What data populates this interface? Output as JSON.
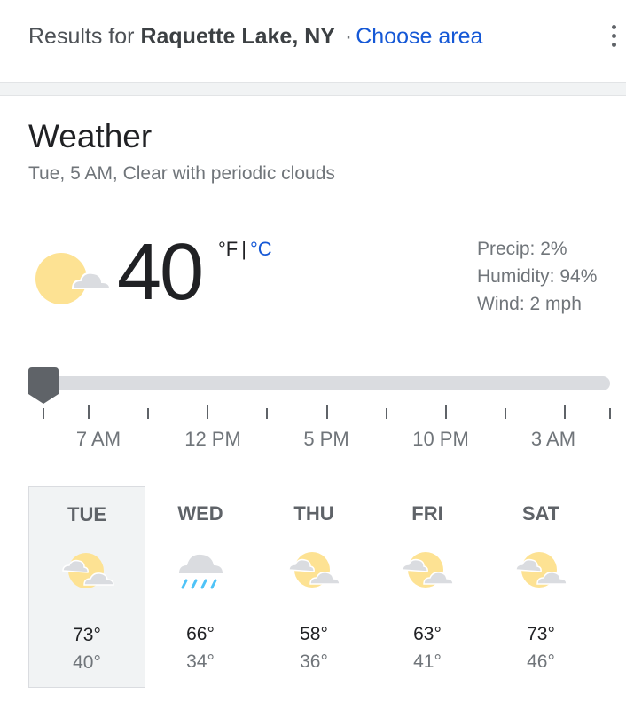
{
  "header": {
    "prefix": "Results for",
    "location": "Raquette Lake, NY",
    "separator": "·",
    "choose_area": "Choose area",
    "menu_icon": "more-vert-icon"
  },
  "weather": {
    "title": "Weather",
    "subtitle": "Tue, 5 AM, Clear with periodic clouds",
    "current_icon": "partly-cloudy-icon",
    "temperature": "40",
    "unit_f": "°F",
    "unit_sep": "|",
    "unit_c": "°C",
    "details": {
      "precip": "Precip: 2%",
      "humidity": "Humidity: 94%",
      "wind": "Wind: 2 mph"
    },
    "timeline": {
      "labels": [
        "7 AM",
        "12 PM",
        "5 PM",
        "10 PM",
        "3 AM"
      ]
    },
    "forecast": [
      {
        "day": "TUE",
        "icon": "partly-cloudy-icon",
        "high": "73°",
        "low": "40°"
      },
      {
        "day": "WED",
        "icon": "rain-icon",
        "high": "66°",
        "low": "34°"
      },
      {
        "day": "THU",
        "icon": "partly-cloudy-icon",
        "high": "58°",
        "low": "36°"
      },
      {
        "day": "FRI",
        "icon": "partly-cloudy-icon",
        "high": "63°",
        "low": "41°"
      },
      {
        "day": "SAT",
        "icon": "partly-cloudy-icon",
        "high": "73°",
        "low": "46°"
      }
    ],
    "colors": {
      "sun": "#fde293",
      "cloud": "#dadce0",
      "rain": "#4fc3f7",
      "link": "#1558d6"
    }
  }
}
